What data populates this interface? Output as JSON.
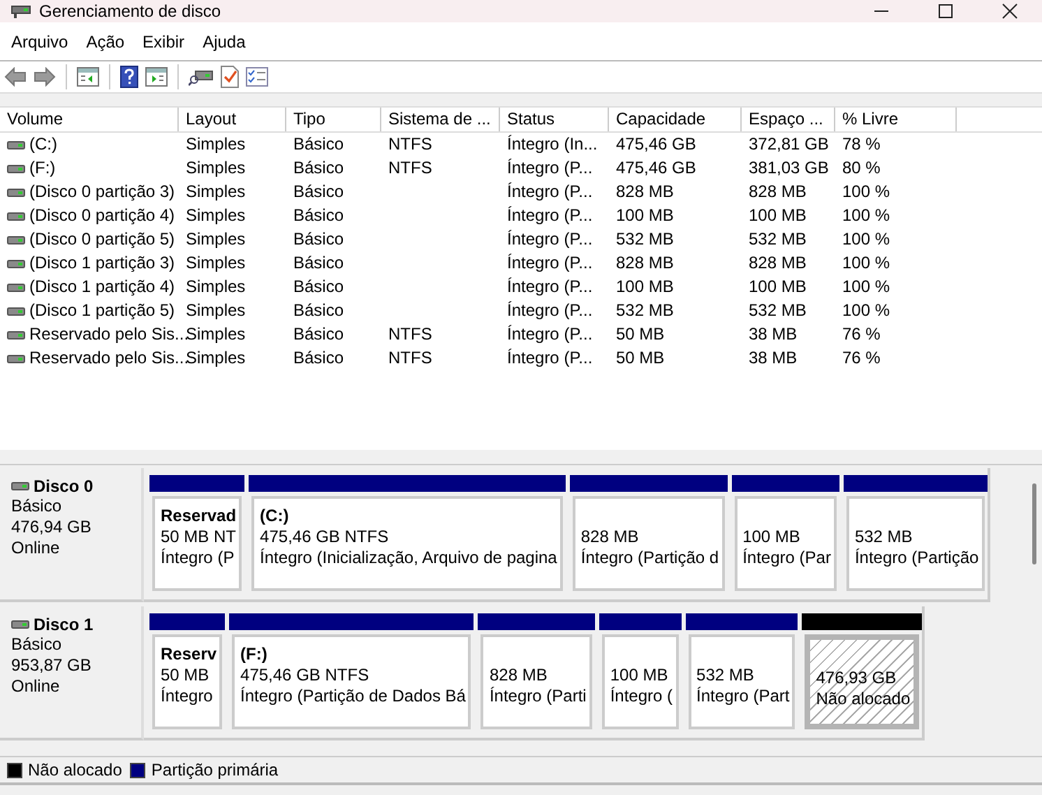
{
  "window": {
    "title": "Gerenciamento de disco"
  },
  "menu": [
    "Arquivo",
    "Ação",
    "Exibir",
    "Ajuda"
  ],
  "table": {
    "columns": [
      "Volume",
      "Layout",
      "Tipo",
      "Sistema de ...",
      "Status",
      "Capacidade",
      "Espaço ...",
      "% Livre"
    ],
    "rows": [
      [
        "(C:)",
        "Simples",
        "Básico",
        "NTFS",
        "Íntegro (In...",
        "475,46 GB",
        "372,81 GB",
        "78 %"
      ],
      [
        "(F:)",
        "Simples",
        "Básico",
        "NTFS",
        "Íntegro (P...",
        "475,46 GB",
        "381,03 GB",
        "80 %"
      ],
      [
        "(Disco 0 partição 3)",
        "Simples",
        "Básico",
        "",
        "Íntegro (P...",
        "828 MB",
        "828 MB",
        "100 %"
      ],
      [
        "(Disco 0 partição 4)",
        "Simples",
        "Básico",
        "",
        "Íntegro (P...",
        "100 MB",
        "100 MB",
        "100 %"
      ],
      [
        "(Disco 0 partição 5)",
        "Simples",
        "Básico",
        "",
        "Íntegro (P...",
        "532 MB",
        "532 MB",
        "100 %"
      ],
      [
        "(Disco 1 partição 3)",
        "Simples",
        "Básico",
        "",
        "Íntegro (P...",
        "828 MB",
        "828 MB",
        "100 %"
      ],
      [
        "(Disco 1 partição 4)",
        "Simples",
        "Básico",
        "",
        "Íntegro (P...",
        "100 MB",
        "100 MB",
        "100 %"
      ],
      [
        "(Disco 1 partição 5)",
        "Simples",
        "Básico",
        "",
        "Íntegro (P...",
        "532 MB",
        "532 MB",
        "100 %"
      ],
      [
        "Reservado pelo Sis...",
        "Simples",
        "Básico",
        "NTFS",
        "Íntegro (P...",
        "50 MB",
        "38 MB",
        "76 %"
      ],
      [
        "Reservado pelo Sis...",
        "Simples",
        "Básico",
        "NTFS",
        "Íntegro (P...",
        "50 MB",
        "38 MB",
        "76 %"
      ]
    ]
  },
  "disks": [
    {
      "name": "Disco 0",
      "type": "Básico",
      "size": "476,94 GB",
      "status": "Online",
      "partitions": [
        {
          "kind": "primary",
          "name": "Reservad",
          "size": "50 MB NT",
          "status": "Íntegro (P"
        },
        {
          "kind": "primary",
          "name": "(C:)",
          "size": "475,46 GB NTFS",
          "status": "Íntegro (Inicialização, Arquivo de pagina"
        },
        {
          "kind": "primary",
          "size": "828 MB",
          "status": "Íntegro (Partição d"
        },
        {
          "kind": "primary",
          "size": "100 MB",
          "status": "Íntegro (Par"
        },
        {
          "kind": "primary",
          "size": "532 MB",
          "status": "Íntegro (Partição"
        }
      ]
    },
    {
      "name": "Disco 1",
      "type": "Básico",
      "size": "953,87 GB",
      "status": "Online",
      "partitions": [
        {
          "kind": "primary",
          "name": "Reserv",
          "size": "50 MB",
          "status": "Íntegro"
        },
        {
          "kind": "primary",
          "name": "(F:)",
          "size": "475,46 GB NTFS",
          "status": "Íntegro (Partição de Dados Bá"
        },
        {
          "kind": "primary",
          "size": "828 MB",
          "status": "Íntegro (Parti"
        },
        {
          "kind": "primary",
          "size": "100 MB",
          "status": "Íntegro ("
        },
        {
          "kind": "primary",
          "size": "532 MB",
          "status": "Íntegro (Part"
        },
        {
          "kind": "unallocated",
          "size": "476,93 GB",
          "status": "Não alocado"
        }
      ]
    }
  ],
  "legend": [
    {
      "label": "Não alocado",
      "color": "#000000"
    },
    {
      "label": "Partição primária",
      "color": "#000080"
    }
  ]
}
